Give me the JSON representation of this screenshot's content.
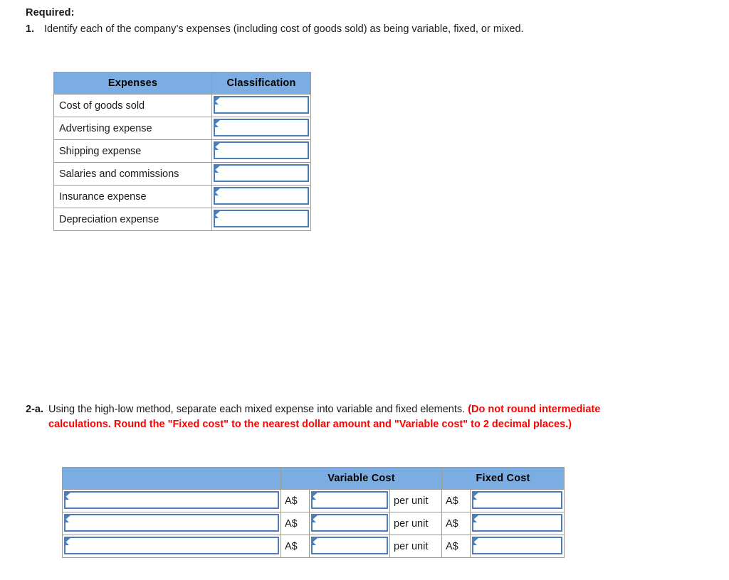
{
  "page": {
    "required_heading": "Required:"
  },
  "question1": {
    "number": "1.",
    "text": "Identify each of the company’s expenses (including cost of goods sold) as being variable, fixed, or mixed."
  },
  "table1": {
    "headers": [
      "Expenses",
      "Classification"
    ],
    "rows": [
      {
        "expense": "Cost of goods sold",
        "classification": ""
      },
      {
        "expense": "Advertising expense",
        "classification": ""
      },
      {
        "expense": "Shipping expense",
        "classification": ""
      },
      {
        "expense": "Salaries and commissions",
        "classification": ""
      },
      {
        "expense": "Insurance expense",
        "classification": ""
      },
      {
        "expense": "Depreciation expense",
        "classification": ""
      }
    ]
  },
  "question2a": {
    "number": "2-a.",
    "text_black": "Using the high-low method, separate each mixed expense into variable and fixed elements. ",
    "text_red": "(Do not round intermediate calculations. Round the \"Fixed cost\" to the nearest dollar amount and \"Variable cost\" to 2 decimal places.)"
  },
  "table2": {
    "headers": [
      "",
      "Variable Cost",
      "Fixed Cost"
    ],
    "currency_symbol": "A$",
    "per_unit_label": "per unit",
    "rows": [
      {
        "expense": "",
        "variable_cost": "",
        "fixed_cost": ""
      },
      {
        "expense": "",
        "variable_cost": "",
        "fixed_cost": ""
      },
      {
        "expense": "",
        "variable_cost": "",
        "fixed_cost": ""
      }
    ]
  },
  "colors": {
    "header_blue": "#7BADE2",
    "input_border_blue": "#4A7EBB",
    "cell_border_gray": "#9B9B9B",
    "alert_red": "#FF0000"
  }
}
